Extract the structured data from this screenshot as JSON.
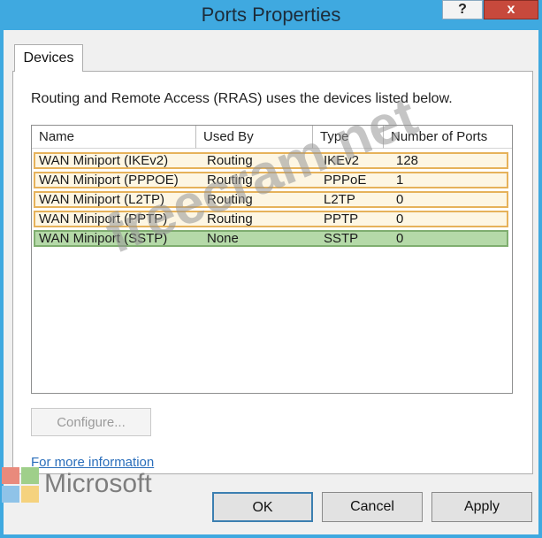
{
  "window": {
    "title": "Ports Properties",
    "help_label": "?",
    "close_label": "x"
  },
  "tabs": [
    {
      "label": "Devices"
    }
  ],
  "description": "Routing and Remote Access (RRAS) uses the devices listed below.",
  "listview": {
    "columns": [
      "Name",
      "Used By",
      "Type",
      "Number of Ports"
    ],
    "rows": [
      {
        "name": "WAN Miniport (IKEv2)",
        "used_by": "Routing",
        "type": "IKEv2",
        "ports": "128"
      },
      {
        "name": "WAN Miniport (PPPOE)",
        "used_by": "Routing",
        "type": "PPPoE",
        "ports": "1"
      },
      {
        "name": "WAN Miniport (L2TP)",
        "used_by": "Routing",
        "type": "L2TP",
        "ports": "0"
      },
      {
        "name": "WAN Miniport (PPTP)",
        "used_by": "Routing",
        "type": "PPTP",
        "ports": "0"
      },
      {
        "name": "WAN Miniport (SSTP)",
        "used_by": "None",
        "type": "SSTP",
        "ports": "0"
      }
    ]
  },
  "configure_label": "Configure...",
  "more_info_label": "For more information",
  "buttons": {
    "ok": "OK",
    "cancel": "Cancel",
    "apply": "Apply"
  },
  "overlay": {
    "watermark": "freecram.net",
    "brand": "Microsoft"
  },
  "colors": {
    "titlebar": "#3fa9e0",
    "row_highlight_border": "#e6b25a",
    "row_selected": "#b5d9a8",
    "close": "#c7493c"
  }
}
